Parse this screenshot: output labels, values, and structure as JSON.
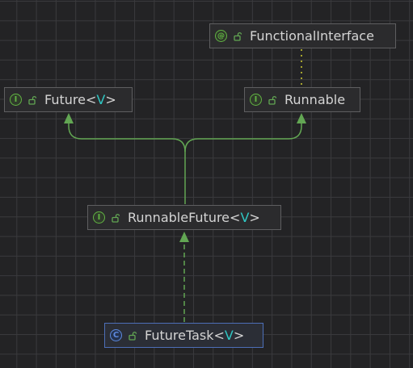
{
  "nodes": {
    "functional_interface": {
      "kind_glyph": "@",
      "name": "FunctionalInterface",
      "kind": "annotation",
      "icon": "annotation-icon"
    },
    "future": {
      "kind_glyph": "I",
      "name": "Future",
      "open": "<",
      "type_param": "V",
      "close": ">",
      "kind": "interface",
      "icon": "interface-icon"
    },
    "runnable": {
      "kind_glyph": "I",
      "name": "Runnable",
      "kind": "interface",
      "icon": "interface-icon"
    },
    "runnable_future": {
      "kind_glyph": "I",
      "name": "RunnableFuture",
      "open": "<",
      "type_param": "V",
      "close": ">",
      "kind": "interface",
      "icon": "interface-icon"
    },
    "future_task": {
      "kind_glyph": "C",
      "name": "FutureTask",
      "open": "<",
      "type_param": "V",
      "close": ">",
      "kind": "class",
      "icon": "class-icon"
    }
  },
  "edges": [
    {
      "from": "runnable_future",
      "to": "future",
      "type": "extends"
    },
    {
      "from": "runnable_future",
      "to": "runnable",
      "type": "extends"
    },
    {
      "from": "future_task",
      "to": "runnable_future",
      "type": "implements"
    },
    {
      "from": "runnable",
      "to": "functional_interface",
      "type": "annotated-by"
    }
  ],
  "colors": {
    "background": "#232325",
    "grid": "#3a3a3d",
    "edge_green": "#62a653",
    "annotation_edge": "#a6a32e",
    "type_param": "#2fc6c2",
    "interface_icon": "#62b543",
    "class_icon": "#5d8ae0"
  }
}
